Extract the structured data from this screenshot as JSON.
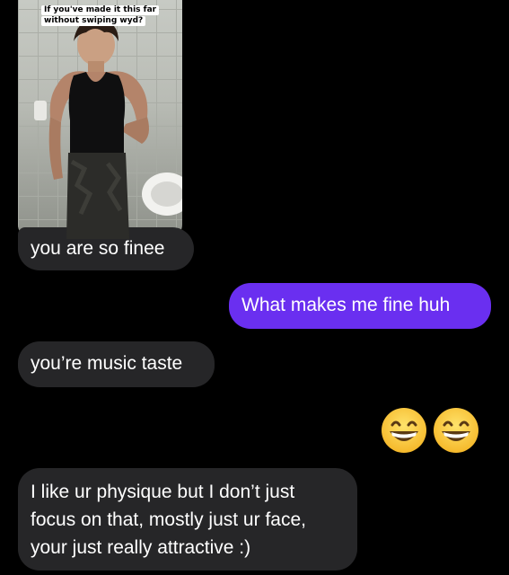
{
  "image_caption": {
    "line1": "If you've made it this far",
    "line2": "without swiping wyd?"
  },
  "messages": [
    {
      "side": "incoming",
      "text": "you are so finee"
    },
    {
      "side": "outgoing",
      "text": "What makes me fine huh"
    },
    {
      "side": "incoming",
      "text": "you’re music taste"
    },
    {
      "side": "outgoing",
      "emoji": "grinning-face-with-smiling-eyes",
      "count": 2
    },
    {
      "side": "incoming",
      "text": "I like ur physique but I don’t just\nfocus on that, mostly just ur face,\nyour just really attractive :)"
    }
  ],
  "colors": {
    "background": "#000000",
    "incoming_bubble": "#262628",
    "outgoing_bubble": "#6a2ff0",
    "text": "#ffffff"
  }
}
